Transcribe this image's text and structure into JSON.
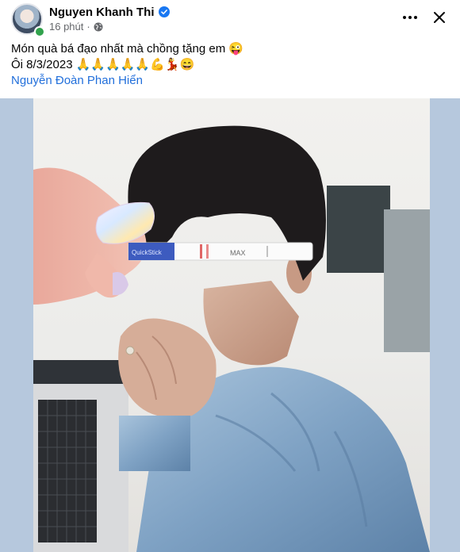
{
  "post": {
    "author": {
      "name": "Nguyen Khanh Thi",
      "verified": true,
      "online": true
    },
    "timestamp": "16 phút",
    "privacy_icon": "globe-icon",
    "caption": {
      "line1": "Món quà bá đạo nhất mà chồng tặng em 😜",
      "line2": "Ôi 8/3/2023 🙏🙏🙏🙏🙏💪💃😄",
      "mention": "Nguyễn Đoàn Phan Hiển"
    },
    "photo": {
      "test_strip_text": "MAX",
      "test_strip_brand": "QuickStick"
    }
  },
  "colors": {
    "link": "#216fdb",
    "verified": "#1877f2",
    "secondary_text": "#65676b",
    "photo_backdrop": "#b6c8dd"
  },
  "icons": [
    "verified-badge-icon",
    "globe-icon",
    "more-options-icon",
    "close-icon"
  ]
}
